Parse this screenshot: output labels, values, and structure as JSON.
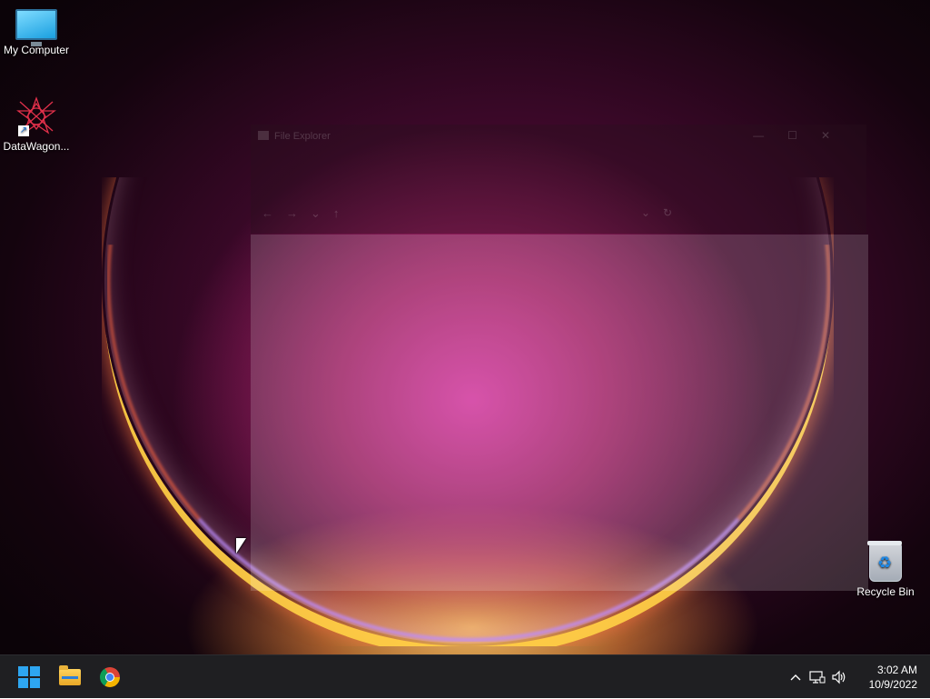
{
  "desktop": {
    "icons": [
      {
        "label": "My Computer",
        "icon": "monitor-icon"
      },
      {
        "label": "DataWagon...",
        "icon": "datawagon-logo-icon"
      },
      {
        "label": "Recycle Bin",
        "icon": "recycle-bin-icon"
      }
    ]
  },
  "ghost_window": {
    "title": "File Explorer",
    "controls": [
      "—",
      "☐",
      "✕"
    ],
    "nav": [
      "←",
      "→",
      "⌄",
      "↑"
    ],
    "nav_right": [
      "⌄",
      "↻"
    ]
  },
  "taskbar": {
    "apps": [
      {
        "name": "Start",
        "icon": "windows-start-icon"
      },
      {
        "name": "File Explorer",
        "icon": "folder-icon"
      },
      {
        "name": "Google Chrome",
        "icon": "chrome-icon"
      }
    ],
    "tray": {
      "chevron": "^",
      "network": "🖧",
      "volume": "🔊"
    },
    "clock": {
      "time": "3:02 AM",
      "date": "10/9/2022"
    }
  },
  "colors": {
    "taskbar_bg": "#1f1f22",
    "start_blue": "#2ea6f1"
  }
}
